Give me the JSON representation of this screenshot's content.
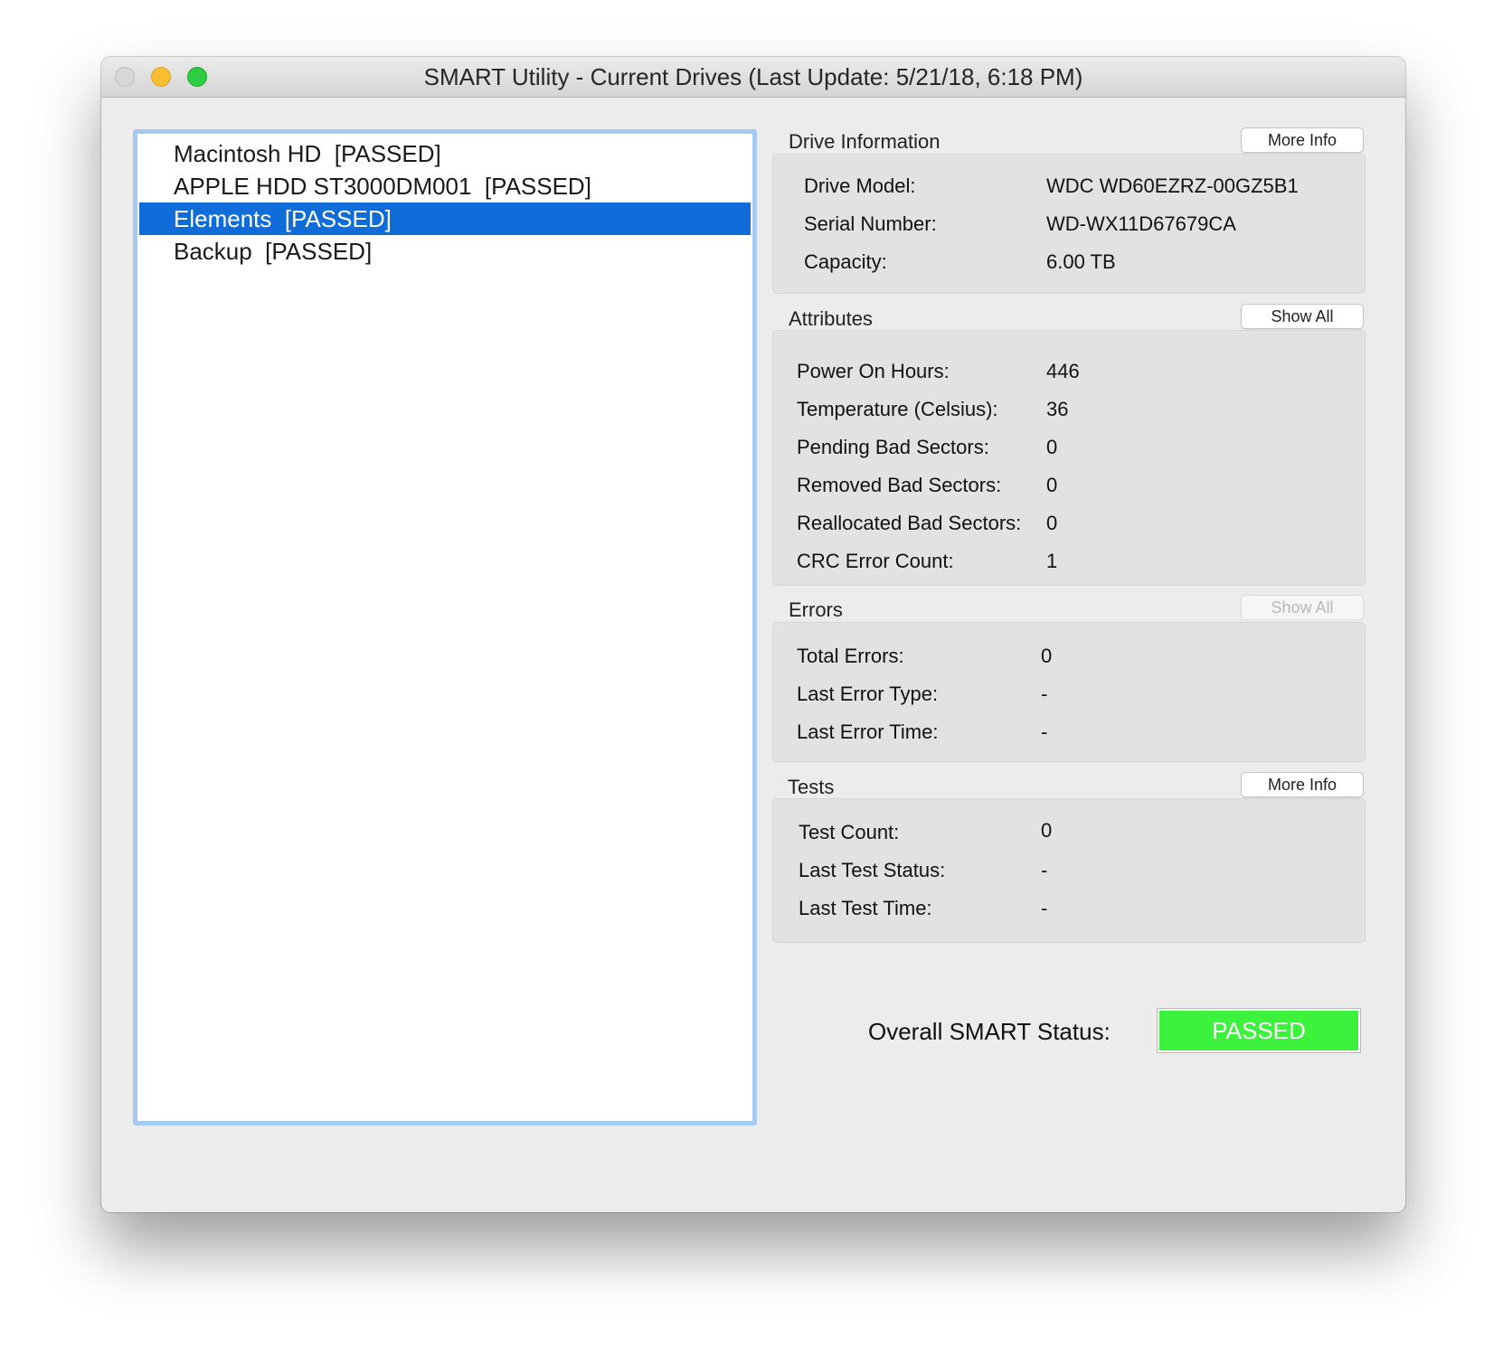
{
  "window": {
    "title": "SMART Utility - Current Drives (Last Update: 5/21/18, 6:18 PM)"
  },
  "drives": [
    {
      "label": "Macintosh HD  [PASSED]",
      "selected": false
    },
    {
      "label": "APPLE HDD ST3000DM001  [PASSED]",
      "selected": false
    },
    {
      "label": "Elements  [PASSED]",
      "selected": true
    },
    {
      "label": "Backup  [PASSED]",
      "selected": false
    }
  ],
  "drive_information": {
    "heading": "Drive Information",
    "button": "More Info",
    "rows": [
      {
        "label": "Drive Model:",
        "value": "WDC WD60EZRZ-00GZ5B1"
      },
      {
        "label": "Serial Number:",
        "value": "WD-WX11D67679CA"
      },
      {
        "label": "Capacity:",
        "value": "6.00 TB"
      }
    ]
  },
  "attributes": {
    "heading": "Attributes",
    "button": "Show All",
    "rows": [
      {
        "label": "Power On Hours:",
        "value": "446"
      },
      {
        "label": "Temperature (Celsius):",
        "value": "36"
      },
      {
        "label": "Pending Bad Sectors:",
        "value": "0"
      },
      {
        "label": "Removed Bad Sectors:",
        "value": "0"
      },
      {
        "label": "Reallocated Bad Sectors:",
        "value": "0"
      },
      {
        "label": "CRC Error Count:",
        "value": "1"
      }
    ]
  },
  "errors": {
    "heading": "Errors",
    "button": "Show All",
    "button_enabled": false,
    "rows": [
      {
        "label": "Total Errors:",
        "value": "0"
      },
      {
        "label": "Last Error Type:",
        "value": "-"
      },
      {
        "label": "Last Error Time:",
        "value": "-"
      }
    ]
  },
  "tests": {
    "heading": "Tests",
    "button": "More Info",
    "rows": [
      {
        "label": "Test Count:",
        "value": "0"
      },
      {
        "label": "Last Test Status:",
        "value": "-"
      },
      {
        "label": "Last Test Time:",
        "value": "-"
      }
    ]
  },
  "overall": {
    "label": "Overall SMART Status:",
    "status": "PASSED",
    "status_color": "#3df23d"
  },
  "colors": {
    "selection": "#0f6cd8",
    "focus_ring": "#a5c9f0"
  }
}
